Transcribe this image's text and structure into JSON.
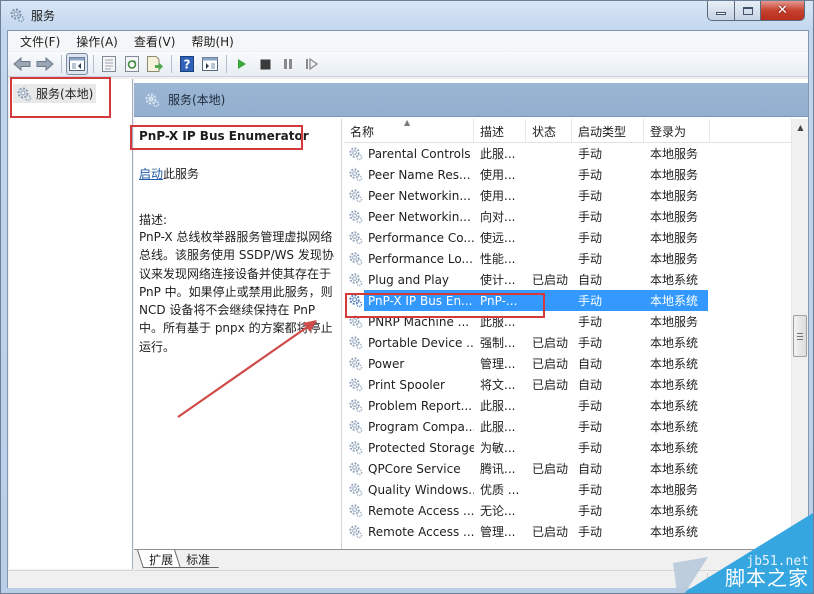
{
  "window": {
    "title": "服务",
    "controls": {
      "minimize": "minimize",
      "maximize": "maximize",
      "close": "close"
    }
  },
  "menu": [
    {
      "label": "文件(F)"
    },
    {
      "label": "操作(A)"
    },
    {
      "label": "查看(V)"
    },
    {
      "label": "帮助(H)"
    }
  ],
  "toolbar": {
    "buttons": [
      "back-icon",
      "forward-icon",
      "show-hide-console-tree-icon",
      "properties-icon",
      "refresh-icon",
      "export-list-icon",
      "help-icon",
      "show-hide-action-pane-icon",
      "start-service-icon",
      "stop-service-icon",
      "pause-service-icon",
      "restart-service-icon"
    ]
  },
  "tree": {
    "root_label": "服务(本地)"
  },
  "pane": {
    "header_title": "服务(本地)",
    "selected_service_title": "PnP-X IP Bus Enumerator",
    "start_link": "启动",
    "start_suffix": "此服务",
    "description_label": "描述:",
    "description_text": "PnP-X 总线枚举器服务管理虚拟网络总线。该服务使用 SSDP/WS 发现协议来发现网络连接设备并使其存在于 PnP 中。如果停止或禁用此服务，则 NCD 设备将不会继续保持在 PnP 中。所有基于 pnpx 的方案都将停止运行。"
  },
  "list": {
    "columns": [
      "名称",
      "描述",
      "状态",
      "启动类型",
      "登录为"
    ],
    "rows": [
      {
        "name": "Parental Controls",
        "desc": "此服...",
        "status": "",
        "startup": "手动",
        "logon": "本地服务"
      },
      {
        "name": "Peer Name Res...",
        "desc": "使用...",
        "status": "",
        "startup": "手动",
        "logon": "本地服务"
      },
      {
        "name": "Peer Networkin...",
        "desc": "使用...",
        "status": "",
        "startup": "手动",
        "logon": "本地服务"
      },
      {
        "name": "Peer Networkin...",
        "desc": "向对...",
        "status": "",
        "startup": "手动",
        "logon": "本地服务"
      },
      {
        "name": "Performance Co...",
        "desc": "使远...",
        "status": "",
        "startup": "手动",
        "logon": "本地服务"
      },
      {
        "name": "Performance Lo...",
        "desc": "性能...",
        "status": "",
        "startup": "手动",
        "logon": "本地服务"
      },
      {
        "name": "Plug and Play",
        "desc": "使计...",
        "status": "已启动",
        "startup": "自动",
        "logon": "本地系统"
      },
      {
        "name": "PnP-X IP Bus En...",
        "desc": "PnP-...",
        "status": "",
        "startup": "手动",
        "logon": "本地系统",
        "selected": true
      },
      {
        "name": "PNRP Machine ...",
        "desc": "此服...",
        "status": "",
        "startup": "手动",
        "logon": "本地服务"
      },
      {
        "name": "Portable Device ...",
        "desc": "强制...",
        "status": "已启动",
        "startup": "手动",
        "logon": "本地系统"
      },
      {
        "name": "Power",
        "desc": "管理...",
        "status": "已启动",
        "startup": "自动",
        "logon": "本地系统"
      },
      {
        "name": "Print Spooler",
        "desc": "将文...",
        "status": "已启动",
        "startup": "自动",
        "logon": "本地系统"
      },
      {
        "name": "Problem Report...",
        "desc": "此服...",
        "status": "",
        "startup": "手动",
        "logon": "本地系统"
      },
      {
        "name": "Program Compa...",
        "desc": "此服...",
        "status": "",
        "startup": "手动",
        "logon": "本地系统"
      },
      {
        "name": "Protected Storage",
        "desc": "为敏...",
        "status": "",
        "startup": "手动",
        "logon": "本地系统"
      },
      {
        "name": "QPCore Service",
        "desc": "腾讯...",
        "status": "已启动",
        "startup": "自动",
        "logon": "本地系统"
      },
      {
        "name": "Quality Windows...",
        "desc": "优质 ...",
        "status": "",
        "startup": "手动",
        "logon": "本地服务"
      },
      {
        "name": "Remote Access ...",
        "desc": "无论...",
        "status": "",
        "startup": "手动",
        "logon": "本地系统"
      },
      {
        "name": "Remote Access ...",
        "desc": "管理...",
        "status": "已启动",
        "startup": "手动",
        "logon": "本地系统"
      }
    ]
  },
  "tabs": [
    {
      "label": "扩展",
      "active": true
    },
    {
      "label": "标准",
      "active": false
    }
  ],
  "annotations": {
    "highlight_color": "#d53a3a",
    "selection_color": "#3399ff"
  },
  "watermark": {
    "domain": "jb51.net",
    "name": "脚本之家"
  }
}
